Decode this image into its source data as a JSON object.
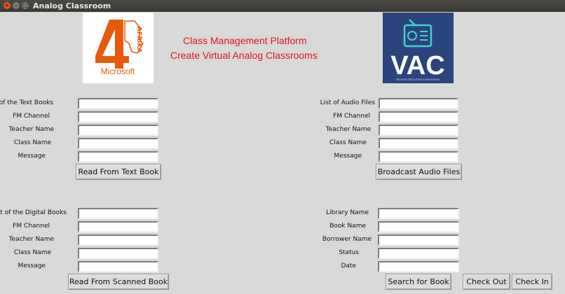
{
  "window": {
    "title": "Analog Classroom"
  },
  "logos": {
    "afrika": {
      "vertical_text": "AFRIKA",
      "brand": "Microsoft",
      "color": "#e8590c"
    },
    "vac": {
      "text": "VAC",
      "tagline": "PROVIDE EDUCATION EVERYWHERE",
      "bg": "#2b447e",
      "accent": "#3fd7c8"
    }
  },
  "header": {
    "line1": "Class Management Platform",
    "line2": "Create Virtual Analog Classrooms",
    "color": "#e21414"
  },
  "text_book_panel": {
    "labels": [
      "List of the Text Books",
      "FM Channel",
      "Teacher Name",
      "Class Name",
      "Message"
    ],
    "values": [
      "",
      "",
      "",
      "",
      ""
    ],
    "button": "Read From Text Book"
  },
  "audio_panel": {
    "labels": [
      "List of Audio Files",
      "FM Channel",
      "Teacher Name",
      "Class Name",
      "Message"
    ],
    "values": [
      "",
      "",
      "",
      "",
      ""
    ],
    "button": "Broadcast Audio Files"
  },
  "digital_book_panel": {
    "labels": [
      "List of the Digital Books",
      "FM Channel",
      "Teacher Name",
      "Class Name",
      "Message"
    ],
    "values": [
      "",
      "",
      "",
      "",
      ""
    ],
    "button": "Read From Scanned Book"
  },
  "library_panel": {
    "labels": [
      "Library Name",
      "Book Name",
      "Borrower Name",
      "Status",
      "Date"
    ],
    "values": [
      "",
      "",
      "",
      "",
      ""
    ],
    "buttons": {
      "search": "Search for Book",
      "checkout": "Check Out",
      "checkin": "Check In"
    }
  }
}
